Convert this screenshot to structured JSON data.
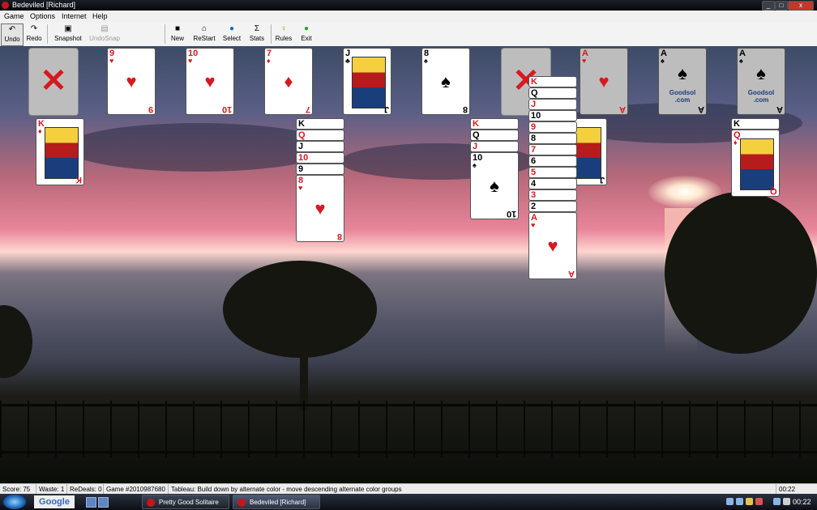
{
  "window": {
    "title": "Bedeviled [Richard]",
    "controls": {
      "minimize": "_",
      "maximize": "□",
      "close": "x"
    }
  },
  "menu": [
    "Game",
    "Options",
    "Internet",
    "Help"
  ],
  "toolbar": [
    {
      "label": "Undo",
      "icon": "undo-icon",
      "glyph": "↶"
    },
    {
      "label": "Redo",
      "icon": "redo-icon",
      "glyph": "↷"
    },
    {
      "label": "Snapshot",
      "icon": "camera-icon",
      "glyph": "▣"
    },
    {
      "label": "UndoSnap",
      "icon": "undo-snapshot-icon",
      "glyph": "▤",
      "disabled": true
    },
    {
      "label": "New",
      "icon": "new-game-icon",
      "glyph": "■"
    },
    {
      "label": "ReStart",
      "icon": "home-icon",
      "glyph": "⌂"
    },
    {
      "label": "Select",
      "icon": "globe-icon",
      "glyph": "●"
    },
    {
      "label": "Stats",
      "icon": "sigma-icon",
      "glyph": "Σ"
    },
    {
      "label": "Rules",
      "icon": "lightbulb-icon",
      "glyph": "♀"
    },
    {
      "label": "Exit",
      "icon": "exit-icon",
      "glyph": "●"
    }
  ],
  "cards": {
    "K": "K",
    "Q": "Q",
    "J": "J",
    "10": "10",
    "9": "9",
    "8": "8",
    "7": "7",
    "6": "6",
    "5": "5",
    "4": "4",
    "3": "3",
    "2": "2",
    "A": "A",
    "heart": "♥",
    "diamond": "♦",
    "spade": "♠",
    "club": "♣",
    "goodsol_line1": "Goodsol",
    "goodsol_line2": ".com"
  },
  "statusbar": {
    "score": "Score: 75",
    "waste": "Waste: 1",
    "redeals": "ReDeals: 0",
    "game": "Game #2010987680",
    "hint": "Tableau: Build down by alternate color - move descending alternate color groups",
    "time": "00:22"
  },
  "taskbar": {
    "search": "Google",
    "tasks": [
      "Pretty Good Solitaire",
      "Bedeviled [Richard]"
    ],
    "clock": "00:22"
  },
  "colors": {
    "red_suit": "#d71920",
    "black_suit": "#000000",
    "taskbar": "#1c212b"
  }
}
